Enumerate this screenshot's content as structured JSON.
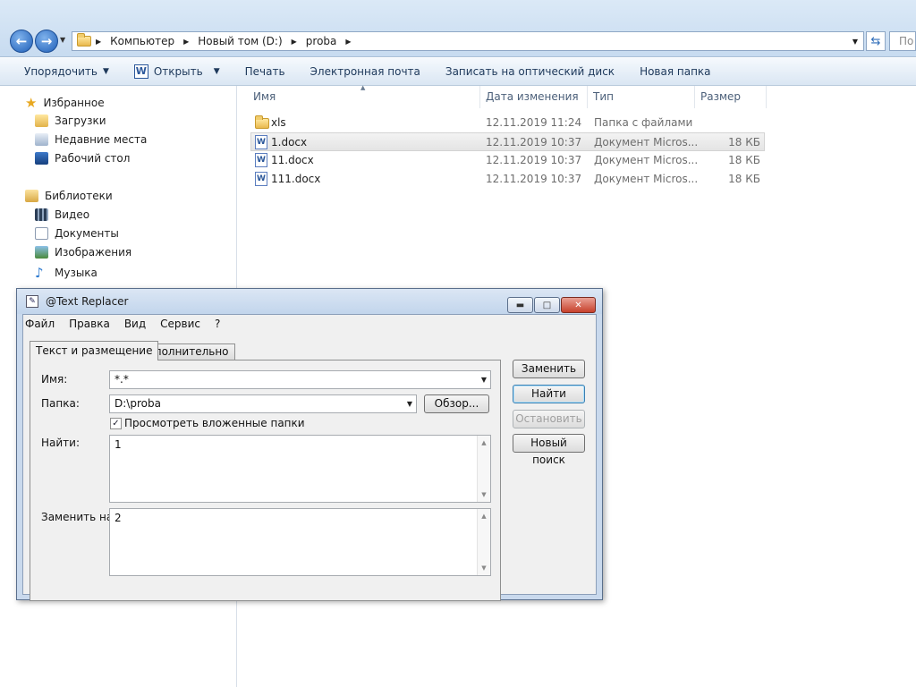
{
  "explorer": {
    "breadcrumb": [
      "Компьютер",
      "Новый том (D:)",
      "proba"
    ],
    "search_placeholder": "По",
    "commands": [
      "Упорядочить",
      "Открыть",
      "Печать",
      "Электронная почта",
      "Записать на оптический диск",
      "Новая папка"
    ],
    "nav": {
      "favorites_label": "Избранное",
      "favorites": [
        "Загрузки",
        "Недавние места",
        "Рабочий стол"
      ],
      "libraries_label": "Библиотеки",
      "libraries": [
        "Видео",
        "Документы",
        "Изображения",
        "Музыка"
      ]
    },
    "columns": [
      "Имя",
      "Дата изменения",
      "Тип",
      "Размер"
    ],
    "files": [
      {
        "name": "xls",
        "date": "12.11.2019 11:24",
        "type": "Папка с файлами",
        "size": "",
        "kind": "folder-icon"
      },
      {
        "name": "1.docx",
        "date": "12.11.2019 10:37",
        "type": "Документ Micros...",
        "size": "18 КБ",
        "kind": "word-doc-icon"
      },
      {
        "name": "11.docx",
        "date": "12.11.2019 10:37",
        "type": "Документ Micros...",
        "size": "18 КБ",
        "kind": "word-doc-icon"
      },
      {
        "name": "111.docx",
        "date": "12.11.2019 10:37",
        "type": "Документ Micros...",
        "size": "18 КБ",
        "kind": "word-doc-icon"
      }
    ],
    "selected_file": "1.docx"
  },
  "dialog": {
    "title": "@Text Replacer",
    "menu": [
      "Файл",
      "Правка",
      "Вид",
      "Сервис",
      "?"
    ],
    "tabs": [
      "Текст и размещение",
      "Дополнительно"
    ],
    "active_tab": "Текст и размещение",
    "name_label": "Имя:",
    "name_value": "*.*",
    "folder_label": "Папка:",
    "folder_value": "D:\\proba",
    "browse_label": "Обзор...",
    "subfolders_label": "Просмотреть вложенные папки",
    "subfolders_checked": true,
    "find_label": "Найти:",
    "find_value": "1",
    "replace_label": "Заменить на:",
    "replace_value": "2",
    "buttons": {
      "replace": "Заменить",
      "find": "Найти",
      "stop": "Остановить",
      "new_search": "Новый поиск"
    }
  },
  "colors": {
    "accent": "#3c7fb1",
    "selection": "#e4e4e4",
    "titlebar": "#c2d5ec"
  }
}
